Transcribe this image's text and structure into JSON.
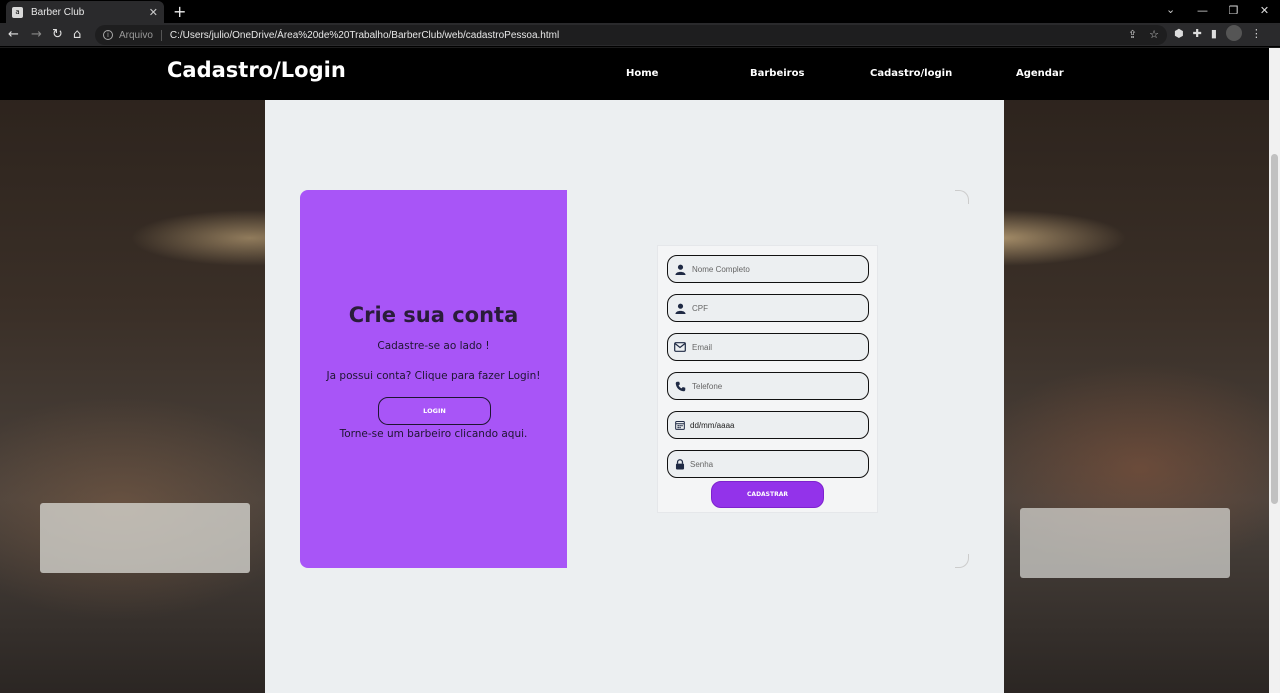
{
  "browser": {
    "tab_title": "Barber Club",
    "tab_favicon": "a",
    "new_tab_symbol": "+",
    "url_prefix": "Arquivo",
    "url": "C:/Users/julio/OneDrive/Área%20de%20Trabalho/BarberClub/web/cadastroPessoa.html"
  },
  "nav": {
    "brand": "Cadastro/Login",
    "links": [
      "Home",
      "Barbeiros",
      "Cadastro/login",
      "Agendar"
    ]
  },
  "left_card": {
    "title": "Crie sua conta",
    "subtitle": "Cadastre-se ao lado !",
    "login_prompt": "Ja possui conta? Clique para fazer Login!",
    "login_button": "LOGIN",
    "barber_link": "Torne-se um barbeiro clicando aqui."
  },
  "form": {
    "fields": [
      {
        "placeholder": "Nome Completo",
        "icon": "user-icon"
      },
      {
        "placeholder": "CPF",
        "icon": "user-icon"
      },
      {
        "placeholder": "Email",
        "icon": "envelope-icon"
      },
      {
        "placeholder": "Telefone",
        "icon": "phone-icon"
      },
      {
        "value": "dd/mm/aaaa",
        "icon": "calendar-icon"
      },
      {
        "placeholder": "Senha",
        "icon": "lock-icon"
      }
    ],
    "submit_label": "CADASTRAR"
  },
  "colors": {
    "card_purple": "#a855f7",
    "button_purple": "#9333ea",
    "nav_bg": "#000000",
    "panel_bg": "#eceff1"
  }
}
